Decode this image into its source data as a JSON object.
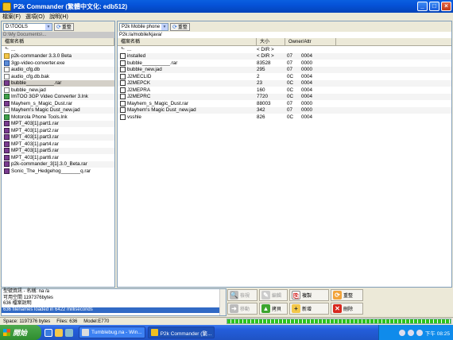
{
  "window": {
    "title": "P2k Commander (繁體中文化: edb512)"
  },
  "menu": [
    "檔案(F)",
    "選項(O)",
    "說明(H)"
  ],
  "left": {
    "drive": "D:\\TOOLS",
    "refresh": "重整",
    "path": "D:\\My Documents\\...",
    "col_name": "檔案名稱",
    "files": [
      {
        "name": "...",
        "type": "up"
      },
      {
        "name": "p2k-commander 3.3.0 Beta",
        "type": "folder"
      },
      {
        "name": "3gp-video-converter.exe",
        "type": "exe"
      },
      {
        "name": "audio_cfg.db",
        "type": "file"
      },
      {
        "name": "audio_cfg.db.bak",
        "type": "file"
      },
      {
        "name": "bubble__________.rar",
        "type": "rar",
        "selected": true
      },
      {
        "name": "bubble_new.jad",
        "type": "file"
      },
      {
        "name": "ImTOO 3GP Video Converter 3.lnk",
        "type": "lnk"
      },
      {
        "name": "Mayhem_s_Magic_Dust.rar",
        "type": "rar"
      },
      {
        "name": "Mayhem's Magic Dust_new.jad",
        "type": "file"
      },
      {
        "name": "Motorola Phone Tools.lnk",
        "type": "lnk"
      },
      {
        "name": "MPT_403[1].part1.rar",
        "type": "rar"
      },
      {
        "name": "MPT_403[1].part2.rar",
        "type": "rar"
      },
      {
        "name": "MPT_403[1].part3.rar",
        "type": "rar"
      },
      {
        "name": "MPT_403[1].part4.rar",
        "type": "rar"
      },
      {
        "name": "MPT_403[1].part5.rar",
        "type": "rar"
      },
      {
        "name": "MPT_403[1].part6.rar",
        "type": "rar"
      },
      {
        "name": "p2k-commander_3[1].3.0_Beta.rar",
        "type": "rar"
      },
      {
        "name": "Sonic_The_Hedgehog_______q.rar",
        "type": "rar"
      }
    ]
  },
  "right": {
    "drive": "P2k Mobile phone",
    "refresh": "重整",
    "path": "P2k:/a/mobile/kjava/",
    "col_name": "檔案名稱",
    "col_size": "大小",
    "col_attr": "Owner/Attr",
    "files": [
      {
        "name": "...",
        "type": "up",
        "size": "< DIR >",
        "owner": "",
        "attr": ""
      },
      {
        "name": "installed",
        "type": "jar",
        "size": "< DIR >",
        "owner": "07",
        "attr": "0004"
      },
      {
        "name": "bubble__________.rar",
        "type": "jar",
        "size": "83528",
        "owner": "07",
        "attr": "0000"
      },
      {
        "name": "bubble_new.jad",
        "type": "jar",
        "size": "295",
        "owner": "07",
        "attr": "0000"
      },
      {
        "name": "J2MECLID",
        "type": "jar",
        "size": "2",
        "owner": "0C",
        "attr": "0004"
      },
      {
        "name": "J2MEPCK",
        "type": "jar",
        "size": "23",
        "owner": "0C",
        "attr": "0004"
      },
      {
        "name": "J2MEPRA",
        "type": "jar",
        "size": "160",
        "owner": "0C",
        "attr": "0004"
      },
      {
        "name": "J2MEPRC",
        "type": "jar",
        "size": "7720",
        "owner": "0C",
        "attr": "0004"
      },
      {
        "name": "Mayhem_s_Magic_Dust.rar",
        "type": "jar",
        "size": "88003",
        "owner": "07",
        "attr": "0000"
      },
      {
        "name": "Mayhem's Magic Dust_new.jad",
        "type": "jar",
        "size": "342",
        "owner": "07",
        "attr": "0000"
      },
      {
        "name": "vsshle",
        "type": "jar",
        "size": "826",
        "owner": "0C",
        "attr": "0004"
      }
    ]
  },
  "info": {
    "lines": [
      "型號資訊 -           名稱: na /a",
      "可用空間      1197376bytes",
      "636 檔案說明",
      "636 filenames loaded in 6422 milliseconds"
    ]
  },
  "buttons": {
    "view": "檢視",
    "edit": "編輯",
    "copy": "複製",
    "refresh": "重整",
    "move": "移動",
    "upload": "拷貝",
    "newdir": "新增",
    "delete": "刪除"
  },
  "status": {
    "space": "Space: 1197376 bytes",
    "files": "Files: 636",
    "mode": "Model:E770"
  },
  "progress": 1.0,
  "taskbar": {
    "start": "開始",
    "tasks": [
      "Tumblebug.na - Win...",
      "P2k Commander (繁..."
    ],
    "clock": "下午 08:25"
  }
}
